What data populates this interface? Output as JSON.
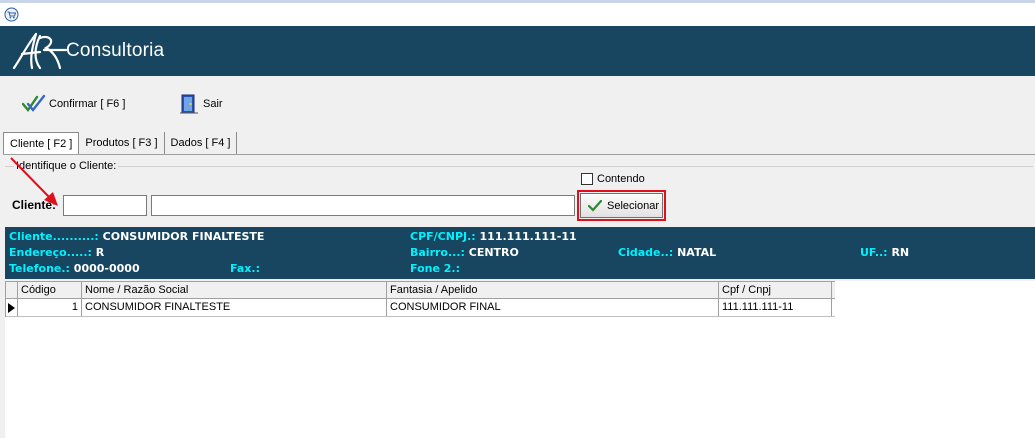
{
  "banner": {
    "title": "Consultoria"
  },
  "toolbar": {
    "confirm_label": "Confirmar [ F6 ]",
    "exit_label": "Sair"
  },
  "tabs": [
    {
      "label": "Cliente [ F2 ]",
      "active": true
    },
    {
      "label": "Produtos [ F3 ]",
      "active": false
    },
    {
      "label": "Dados [ F4 ]",
      "active": false
    }
  ],
  "identify": {
    "group_label": "Identifique o Cliente:",
    "contendo_label": "Contendo",
    "contendo_checked": false,
    "cliente_label": "Cliente:",
    "code_value": "",
    "name_value": "",
    "select_label": "Selecionar"
  },
  "info": {
    "cliente_label": "Cliente..........:",
    "cliente_value": "CONSUMIDOR FINALTESTE",
    "cpf_label": "CPF/CNPJ.:",
    "cpf_value": "111.111.111-11",
    "endereco_label": "Endereço.....:",
    "endereco_value": "R",
    "bairro_label": "Bairro...:",
    "bairro_value": "CENTRO",
    "cidade_label": "Cidade..:",
    "cidade_value": "NATAL",
    "uf_label": "UF..:",
    "uf_value": "RN",
    "telefone_label": "Telefone.:",
    "telefone_value": "0000-0000",
    "fax_label": "Fax.:",
    "fax_value": "",
    "fone2_label": "Fone 2.:",
    "fone2_value": ""
  },
  "grid": {
    "columns": [
      "Código",
      "Nome / Razão Social",
      "Fantasia / Apelido",
      "Cpf / Cnpj"
    ],
    "rows": [
      [
        "1",
        "CONSUMIDOR FINALTESTE",
        "CONSUMIDOR FINAL",
        "111.111.111-11"
      ]
    ]
  },
  "colors": {
    "banner_bg": "#184660",
    "info_label": "#00f2ff",
    "highlight": "#e0101a"
  }
}
